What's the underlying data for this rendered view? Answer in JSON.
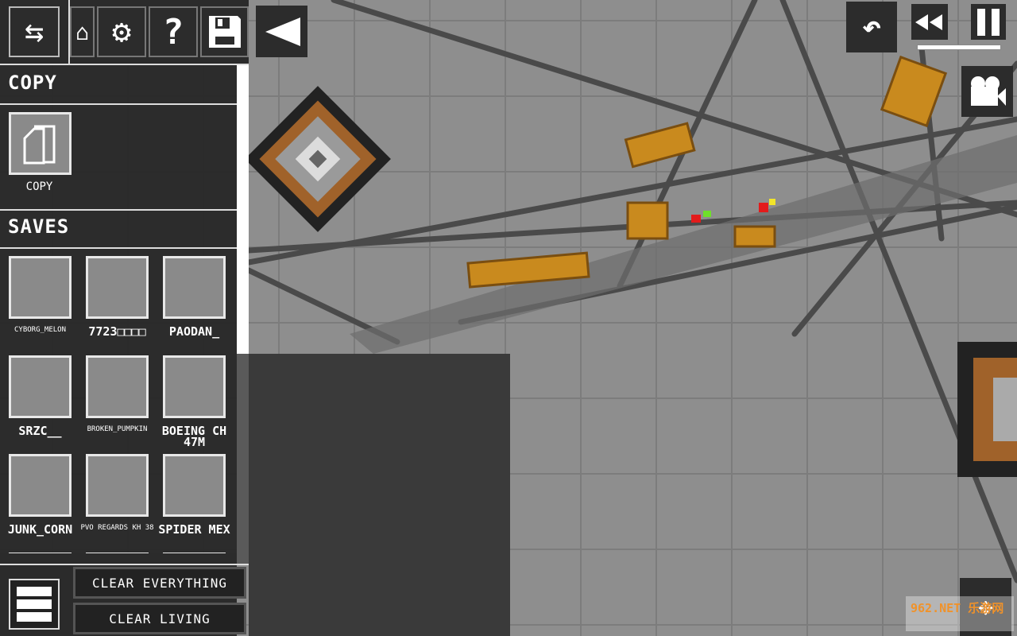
{
  "toolbar": {
    "icons": [
      "swap-arrows-icon",
      "hanger-icon",
      "gear-icon",
      "help-icon",
      "save-icon",
      "collapse-triangle-icon"
    ],
    "help_glyph": "?"
  },
  "copy_section": {
    "title": "COPY",
    "item_label": "COPY"
  },
  "saves_section": {
    "title": "SAVES",
    "items": [
      {
        "label": "CYBORG_MELON"
      },
      {
        "label": "7723□□□□"
      },
      {
        "label": "PAODAN_"
      },
      {
        "label": "SRZC__"
      },
      {
        "label": "BROKEN_PUMPKIN"
      },
      {
        "label": "BOEING CH 47M"
      },
      {
        "label": "JUNK_CORN"
      },
      {
        "label": "PVO REGARDS KH 38"
      },
      {
        "label": "SPIDER MEX"
      }
    ]
  },
  "bottom": {
    "clear_everything": "CLEAR EVERYTHING",
    "clear_living": "CLEAR LIVING"
  },
  "controls": {
    "icons": [
      "undo-icon",
      "rewind-icon",
      "pause-icon",
      "camera-icon",
      "move-arrows-icon"
    ],
    "time_scale": 1.0
  },
  "watermark": {
    "text": "962.NET 乐游网"
  }
}
